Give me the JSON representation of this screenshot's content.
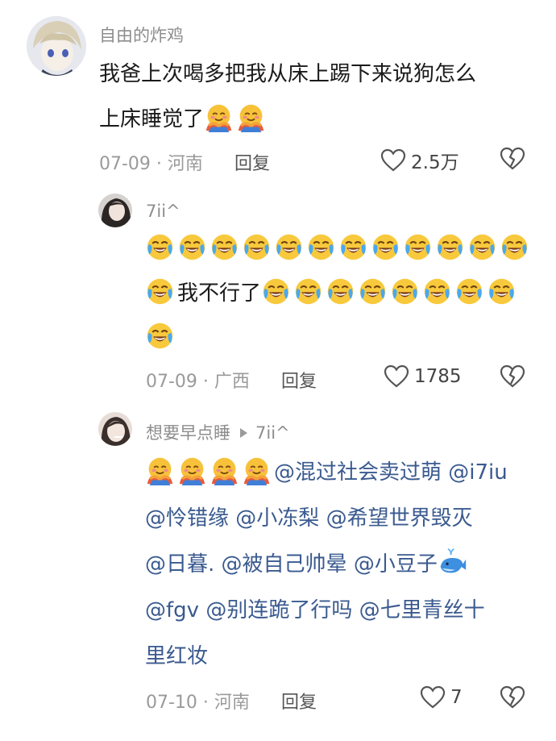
{
  "colors": {
    "mention": "#3a5a8f",
    "meta": "#9a9a9a",
    "username": "#8d8d8d"
  },
  "comment1": {
    "username": "自由的炸鸡",
    "line1": "我爸上次喝多把我从床上踢下来说狗怎么",
    "line2": "上床睡觉了",
    "line2_emojis": [
      "hug-emoji",
      "hug-emoji"
    ],
    "date": "07-09",
    "location": "河南",
    "reply_label": "回复",
    "likes": "2.5万"
  },
  "reply1": {
    "username": "7ii^",
    "row1_emojis": [
      "laugh-cry-emoji",
      "laugh-cry-emoji",
      "laugh-cry-emoji",
      "laugh-cry-emoji",
      "laugh-cry-emoji",
      "laugh-cry-emoji",
      "laugh-cry-emoji",
      "laugh-cry-emoji",
      "laugh-cry-emoji",
      "laugh-cry-emoji",
      "laugh-cry-emoji",
      "laugh-cry-emoji"
    ],
    "row2_text": "我不行了",
    "date": "07-09",
    "location": "广西",
    "reply_label": "回复",
    "likes": "1785"
  },
  "reply2": {
    "username": "想要早点睡",
    "reply_to": "7ii^",
    "mentions": [
      "@混过社会卖过萌",
      "@i7iu",
      "@怜错缘",
      "@小冻梨",
      "@希望世界毁灭",
      "@日暮.",
      "@被自己帅晕",
      "@小豆子",
      "@fgv",
      "@别连跪了行吗",
      "@七里青丝十",
      "里红妆"
    ],
    "date": "07-10",
    "location": "河南",
    "reply_label": "回复",
    "likes": "7"
  }
}
